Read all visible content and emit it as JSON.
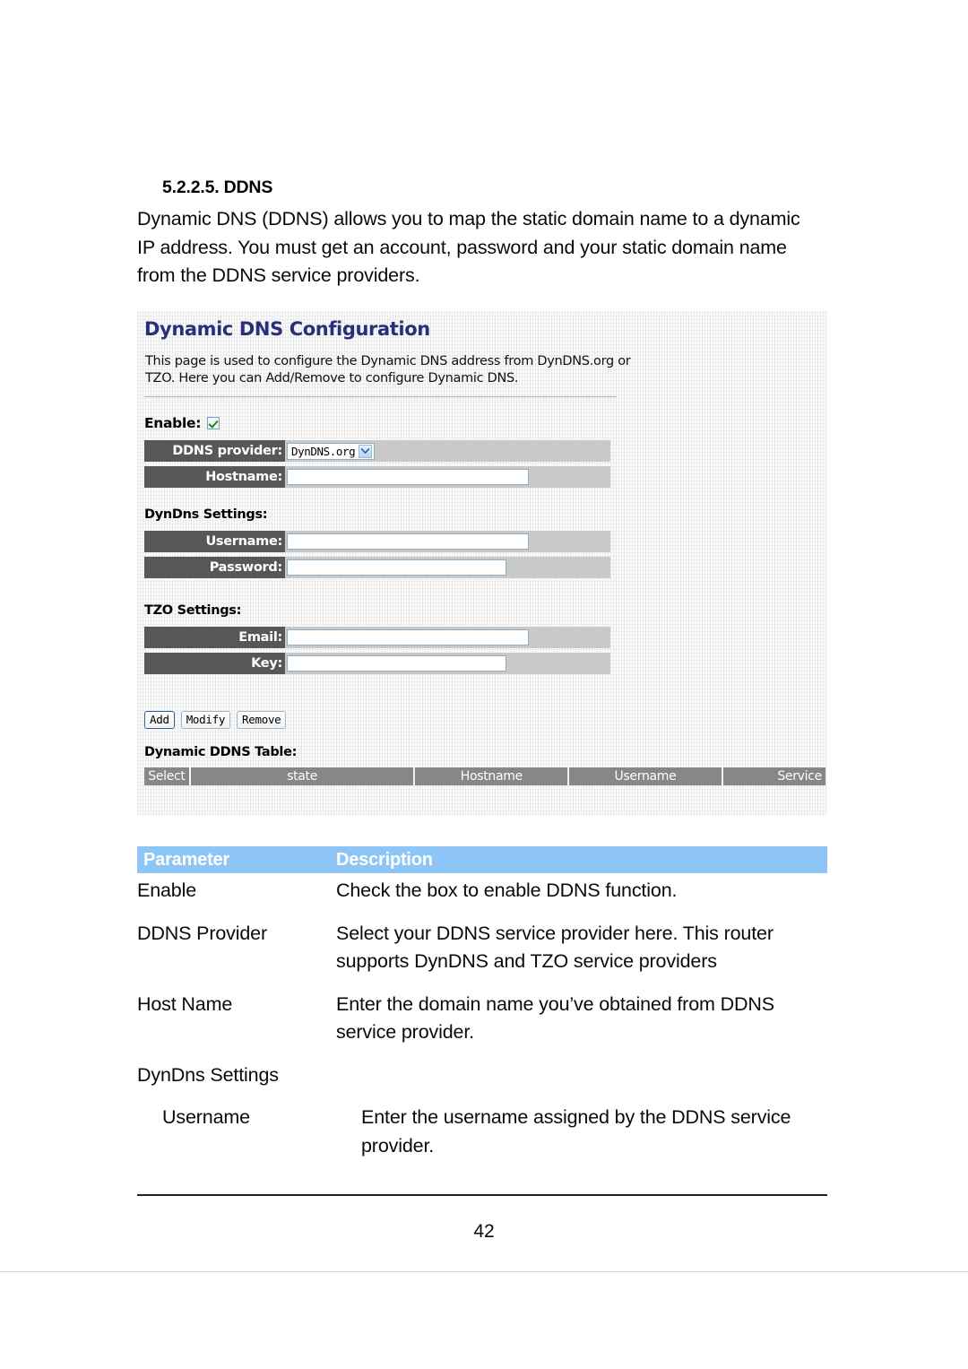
{
  "document": {
    "section_number_title": "5.2.2.5. DDNS",
    "intro_paragraph": "Dynamic DNS (DDNS) allows you to map the static domain name to a dynamic IP address. You must get an account, password and your static domain name from the DDNS service providers.",
    "page_number": "42"
  },
  "router_screenshot": {
    "title": "Dynamic DNS Configuration",
    "description": "This page is used to configure the Dynamic DNS address from DynDNS.org or TZO. Here you can Add/Remove to configure Dynamic DNS.",
    "enable_label": "Enable:",
    "enable_checked": true,
    "fields": {
      "ddns_provider_label": "DDNS provider:",
      "ddns_provider_value": "DynDNS.org",
      "hostname_label": "Hostname:",
      "hostname_value": ""
    },
    "dyndns_group": {
      "title": "DynDns Settings:",
      "username_label": "Username:",
      "username_value": "",
      "password_label": "Password:",
      "password_value": ""
    },
    "tzo_group": {
      "title": "TZO Settings:",
      "email_label": "Email:",
      "email_value": "",
      "key_label": "Key:",
      "key_value": ""
    },
    "buttons": {
      "add": "Add",
      "modify": "Modify",
      "remove": "Remove"
    },
    "table": {
      "title": "Dynamic DDNS Table:",
      "columns": [
        "Select",
        "state",
        "Hostname",
        "Username",
        "Service"
      ],
      "rows": []
    },
    "colors": {
      "title_blue": "#2b2f7a",
      "label_dark": "#575757",
      "row_gray": "#c9c9c9",
      "table_header_gray": "#878787",
      "check_green": "#158a1e",
      "input_border_blue": "#8fadc4"
    }
  },
  "parameter_table": {
    "header": {
      "parameter": "Parameter",
      "description": "Description"
    },
    "header_color": "#8ec5f7",
    "rows": [
      {
        "parameter": "Enable",
        "indent": false,
        "description": "Check the box to enable DDNS function."
      },
      {
        "parameter": "DDNS Provider",
        "indent": false,
        "description": "Select your DDNS service provider here. This router supports DynDNS and TZO service providers"
      },
      {
        "parameter": "Host Name",
        "indent": false,
        "description": "Enter the domain name you’ve obtained from DDNS service provider."
      },
      {
        "parameter": "DynDns Settings",
        "indent": false,
        "description": ""
      },
      {
        "parameter": "Username",
        "indent": true,
        "description": "Enter the username assigned by the DDNS service provider."
      }
    ]
  }
}
